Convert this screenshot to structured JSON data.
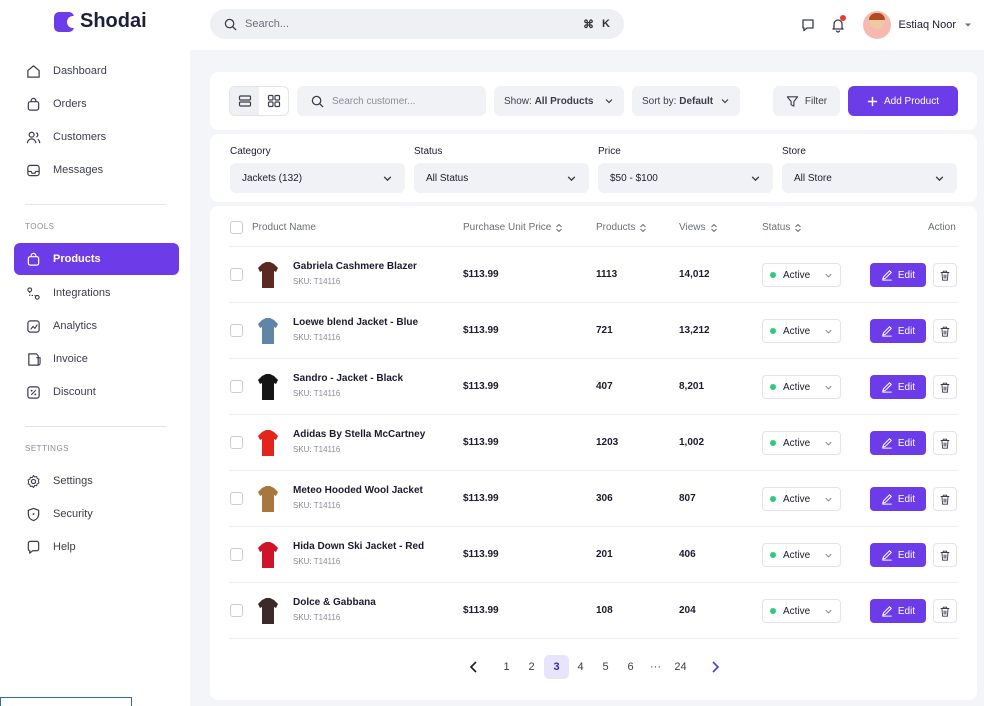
{
  "app": {
    "logo": "Shodai"
  },
  "search": {
    "placeholder": "Search...",
    "shortcut_cmd": "⌘",
    "shortcut_key": "K"
  },
  "user": {
    "name": "Estiaq Noor"
  },
  "sidebar": {
    "main": [
      {
        "label": "Dashboard",
        "icon": "home-icon"
      },
      {
        "label": "Orders",
        "icon": "bag-icon"
      },
      {
        "label": "Customers",
        "icon": "users-icon"
      },
      {
        "label": "Messages",
        "icon": "message-icon"
      }
    ],
    "tools_label": "TOOLS",
    "tools": [
      {
        "label": "Products",
        "icon": "bag-icon",
        "active": true
      },
      {
        "label": "Integrations",
        "icon": "integration-icon"
      },
      {
        "label": "Analytics",
        "icon": "analytics-icon"
      },
      {
        "label": "Invoice",
        "icon": "invoice-icon"
      },
      {
        "label": "Discount",
        "icon": "discount-icon"
      }
    ],
    "settings_label": "SETTINGS",
    "settings": [
      {
        "label": "Settings",
        "icon": "gear-icon"
      },
      {
        "label": "Security",
        "icon": "shield-icon"
      },
      {
        "label": "Help",
        "icon": "help-icon"
      }
    ]
  },
  "toolbar": {
    "search_placeholder": "Search customer...",
    "show_prefix": "Show:",
    "show_value": "All Products",
    "sort_prefix": "Sort by:",
    "sort_value": "Default",
    "filter_label": "Filter",
    "add_label": "Add Product"
  },
  "filters": [
    {
      "label": "Category",
      "value": "Jackets (132)"
    },
    {
      "label": "Status",
      "value": "All Status"
    },
    {
      "label": "Price",
      "value": "$50 - $100"
    },
    {
      "label": "Store",
      "value": "All Store"
    }
  ],
  "table": {
    "headers": {
      "name": "Product Name",
      "price": "Purchase Unit Price",
      "products": "Products",
      "views": "Views",
      "status": "Status",
      "action": "Action"
    },
    "edit_label": "Edit",
    "rows": [
      {
        "name": "Gabriela Cashmere Blazer",
        "sku": "SKU: T14116",
        "price": "$113.99",
        "products": "1113",
        "views": "14,012",
        "status": "Active",
        "color": "#5a2a22"
      },
      {
        "name": "Loewe blend Jacket - Blue",
        "sku": "SKU: T14116",
        "price": "$113.99",
        "products": "721",
        "views": "13,212",
        "status": "Active",
        "color": "#5f86a8"
      },
      {
        "name": "Sandro - Jacket - Black",
        "sku": "SKU: T14116",
        "price": "$113.99",
        "products": "407",
        "views": "8,201",
        "status": "Active",
        "color": "#151515"
      },
      {
        "name": "Adidas By Stella McCartney",
        "sku": "SKU: T14116",
        "price": "$113.99",
        "products": "1203",
        "views": "1,002",
        "status": "Active",
        "color": "#e2261c"
      },
      {
        "name": "Meteo Hooded Wool Jacket",
        "sku": "SKU: T14116",
        "price": "$113.99",
        "products": "306",
        "views": "807",
        "status": "Active",
        "color": "#a8773e"
      },
      {
        "name": "Hida Down Ski Jacket - Red",
        "sku": "SKU: T14116",
        "price": "$113.99",
        "products": "201",
        "views": "406",
        "status": "Active",
        "color": "#d01428"
      },
      {
        "name": "Dolce & Gabbana",
        "sku": "SKU: T14116",
        "price": "$113.99",
        "products": "108",
        "views": "204",
        "status": "Active",
        "color": "#3a2a2a"
      }
    ]
  },
  "pagination": {
    "pages": [
      "1",
      "2",
      "3",
      "4",
      "5",
      "6",
      "···",
      "24"
    ],
    "current": "3"
  },
  "colors": {
    "accent": "#6c3ce9",
    "active_dot": "#2fcb7c"
  }
}
